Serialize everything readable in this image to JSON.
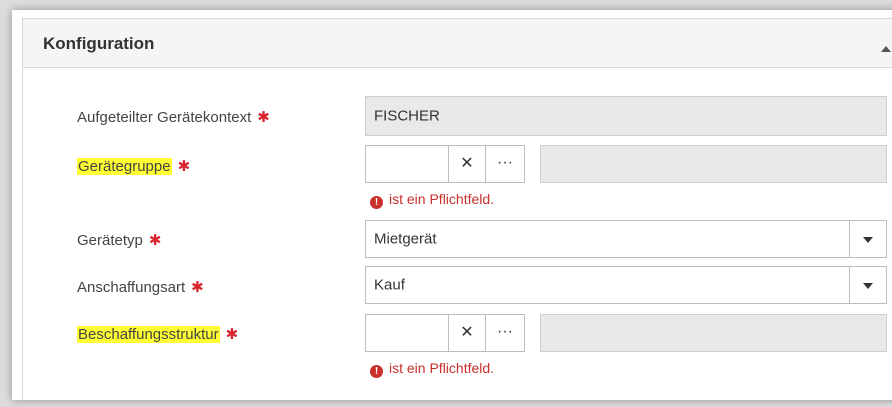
{
  "panel": {
    "title": "Konfiguration"
  },
  "required_marker": "✱",
  "rows": {
    "context": {
      "label": "Aufgeteilter Gerätekontext",
      "value": "FISCHER"
    },
    "group": {
      "label": "Gerätegruppe",
      "value": "",
      "error": "ist ein Pflichtfeld."
    },
    "type": {
      "label": "Gerätetyp",
      "value": "Mietgerät"
    },
    "acquisition": {
      "label": "Anschaffungsart",
      "value": "Kauf"
    },
    "procurement": {
      "label": "Beschaffungsstruktur",
      "value": "",
      "error": "ist ein Pflichtfeld."
    }
  },
  "buttons": {
    "clear": "✕",
    "more": "···"
  },
  "error_icon": "!",
  "colors": {
    "required": "#d9232d",
    "highlight": "#ffff33",
    "error": "#c9302c"
  }
}
